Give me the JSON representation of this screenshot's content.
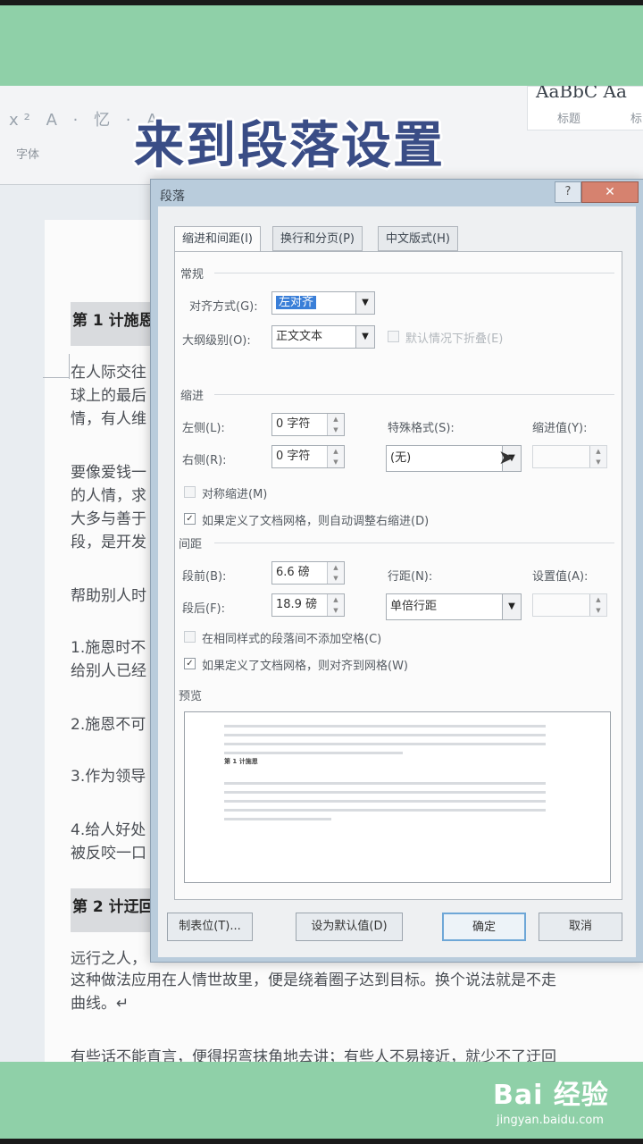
{
  "overlay": {
    "title": "来到段落设置"
  },
  "ribbon": {
    "tools": "x² A · 忆 · A",
    "font_group": "字体",
    "style_preview": "AaBbC Aa",
    "style_label": "标题",
    "style_label2": "标"
  },
  "document": {
    "heading1": "第 1 计施恩",
    "p1": [
      "在人际交往",
      "球上的最后",
      "情，有人维"
    ],
    "p2": [
      "要像爱钱一",
      "的人情，求",
      "大多与善于",
      "段，是开发"
    ],
    "p3": "帮助别人时",
    "p4": [
      "1.施恩时不",
      "给别人已经"
    ],
    "p5": "2.施恩不可",
    "p6": "3.作为领导",
    "p7": [
      "4.给人好处",
      "被反咬一口"
    ],
    "heading2": "第 2 计迂回",
    "p8": [
      "远行之人，",
      "这种做法应用在人情世故里，便是绕着圈子达到目标。换个说法就是不走",
      "曲线。↵"
    ],
    "p9": "有些话不能直言，便得拐弯抹角地去讲；有些人不易接近，就少不了迂回"
  },
  "dialog": {
    "title": "段落",
    "help": "?",
    "close": "✕",
    "tabs": [
      "缩进和间距(I)",
      "换行和分页(P)",
      "中文版式(H)"
    ],
    "general": {
      "section": "常规",
      "alignment_label": "对齐方式(G):",
      "alignment_value": "左对齐",
      "outline_label": "大纲级别(O):",
      "outline_value": "正文文本",
      "collapse_label": "默认情况下折叠(E)"
    },
    "indent": {
      "section": "缩进",
      "left_label": "左侧(L):",
      "left_value": "0 字符",
      "right_label": "右侧(R):",
      "right_value": "0 字符",
      "special_label": "特殊格式(S):",
      "special_value": "(无)",
      "by_label": "缩进值(Y):",
      "mirror_label": "对称缩进(M)",
      "auto_adjust_label": "如果定义了文档网格，则自动调整右缩进(D)"
    },
    "spacing": {
      "section": "间距",
      "before_label": "段前(B):",
      "before_value": "6.6 磅",
      "after_label": "段后(F):",
      "after_value": "18.9 磅",
      "line_label": "行距(N):",
      "line_value": "单倍行距",
      "at_label": "设置值(A):",
      "no_space_label": "在相同样式的段落间不添加空格(C)",
      "snap_grid_label": "如果定义了文档网格，则对齐到网格(W)"
    },
    "preview": {
      "section": "预览",
      "sample": "第 1 计施恩"
    },
    "buttons": {
      "tabs": "制表位(T)...",
      "set_default": "设为默认值(D)",
      "ok": "确定",
      "cancel": "取消"
    }
  },
  "watermark": {
    "brand": "Bai 经验",
    "url": "jingyan.baidu.com"
  }
}
